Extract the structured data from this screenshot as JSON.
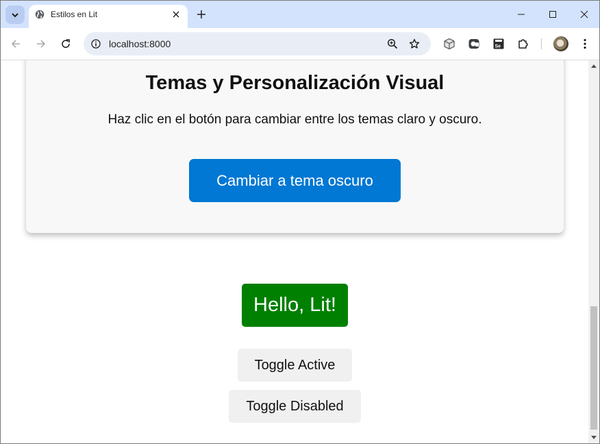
{
  "browser": {
    "tab": {
      "title": "Estilos en Lit",
      "favicon": "globe-icon"
    },
    "address": {
      "url": "localhost:8000"
    },
    "icons": {
      "tab_search": "chevron-down-icon",
      "tab_close": "close-icon",
      "new_tab": "plus-icon",
      "back": "arrow-left-icon",
      "forward": "arrow-right-icon",
      "reload": "reload-icon",
      "site_info": "info-icon",
      "zoom": "zoom-icon",
      "bookmark": "star-icon",
      "extensions": "puzzle-icon",
      "menu": "more-vertical-icon"
    }
  },
  "page": {
    "card": {
      "title": "Temas y Personalización Visual",
      "description": "Haz clic en el botón para cambiar entre los temas claro y oscuro.",
      "theme_button": "Cambiar a tema oscuro"
    },
    "hello_button": "Hello, Lit!",
    "toggle_active": "Toggle Active",
    "toggle_disabled": "Toggle Disabled"
  },
  "colors": {
    "theme_button_bg": "#0078d4",
    "hello_button_bg": "#008000",
    "toggle_bg": "#f0f0f0",
    "tabstrip_bg": "#d3e3fd"
  }
}
